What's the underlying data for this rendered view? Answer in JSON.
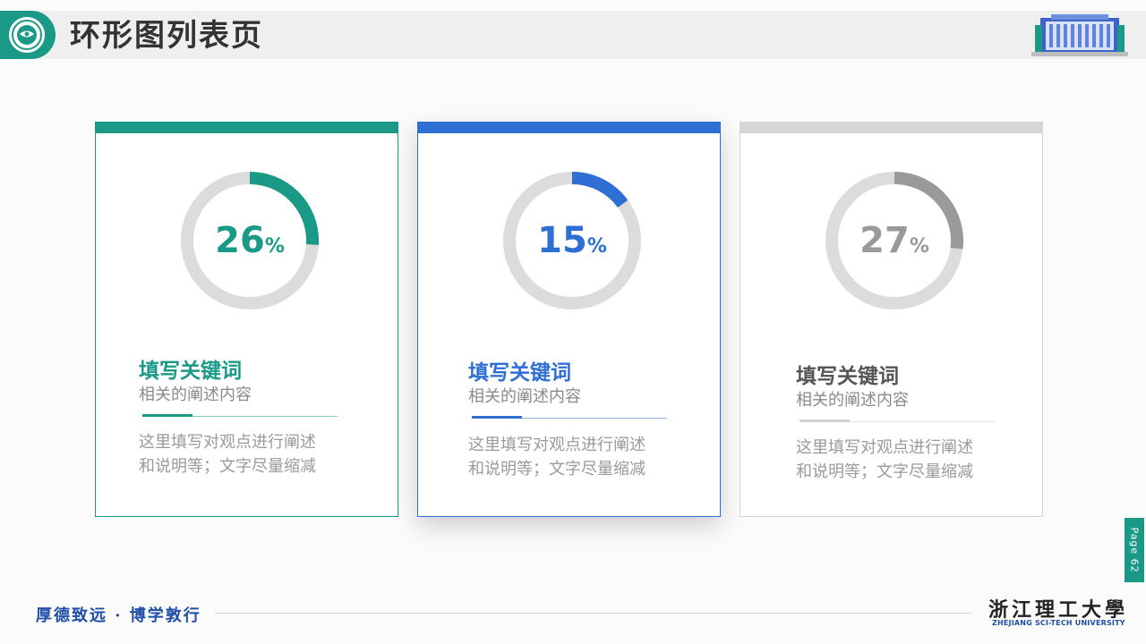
{
  "header": {
    "title": "环形图列表页"
  },
  "cards": [
    {
      "percent_value": "26",
      "percent_symbol": "%",
      "progress": 0.26,
      "keyword": "填写关键词",
      "subtitle": "相关的阐述内容",
      "desc_line1": "这里填写对观点进行阐述",
      "desc_line2": "和说明等；文字尽量缩减",
      "accent_color": "#1a9a86"
    },
    {
      "percent_value": "15",
      "percent_symbol": "%",
      "progress": 0.15,
      "keyword": "填写关键词",
      "subtitle": "相关的阐述内容",
      "desc_line1": "这里填写对观点进行阐述",
      "desc_line2": "和说明等；文字尽量缩减",
      "accent_color": "#2f6fd4"
    },
    {
      "percent_value": "27",
      "percent_symbol": "%",
      "progress": 0.27,
      "keyword": "填写关键词",
      "subtitle": "相关的阐述内容",
      "desc_line1": "这里填写对观点进行阐述",
      "desc_line2": "和说明等；文字尽量缩减",
      "accent_color": "#9a9a9a"
    }
  ],
  "footer": {
    "motto": "厚德致远 · 博学敦行",
    "university_cn": "浙江理工大學",
    "university_en": "ZHEJIANG SCI-TECH UNIVERSITY",
    "page_label": "Page 62"
  },
  "colors": {
    "teal": "#1a9a86",
    "blue": "#2f6fd4",
    "gray": "#9a9a9a",
    "ring_track": "#dcdcdc"
  },
  "icons": {
    "logo": "university-emblem-icon",
    "building": "building-icon"
  }
}
